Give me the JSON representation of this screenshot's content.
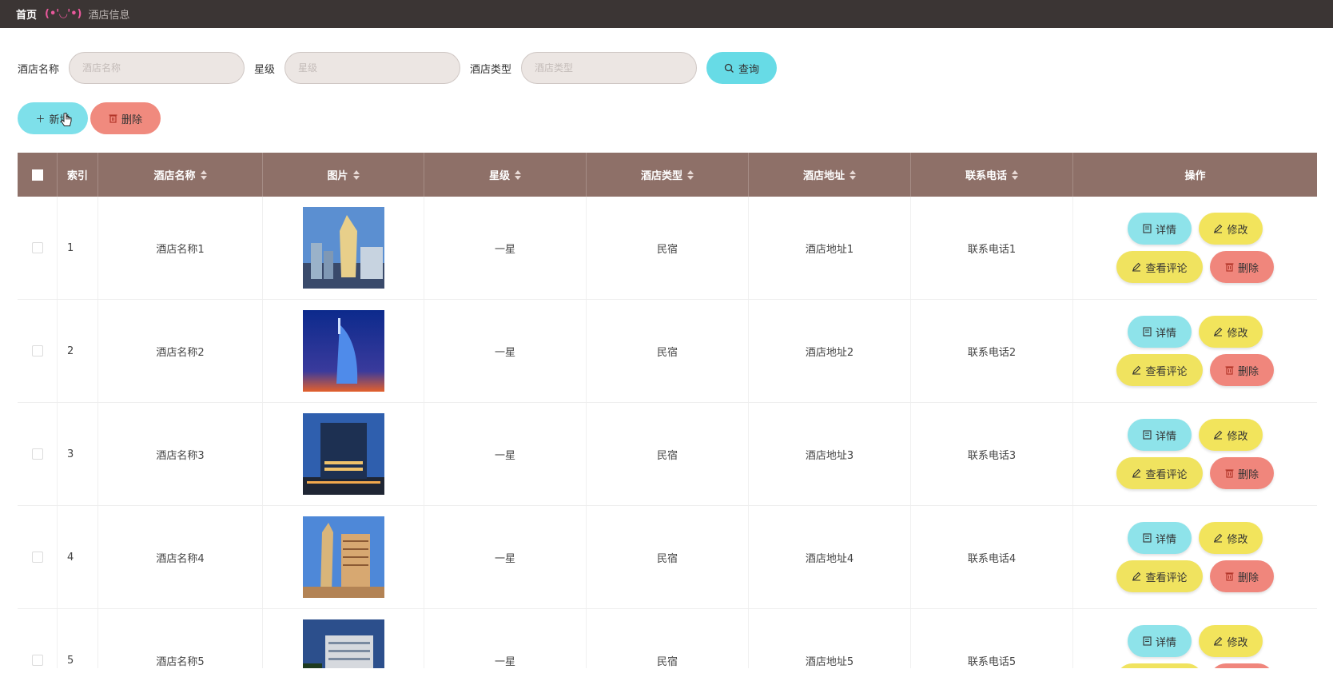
{
  "breadcrumb": {
    "home": "首页",
    "emoji": "(•'◡'•)",
    "current": "酒店信息"
  },
  "search": {
    "fields": [
      {
        "label": "酒店名称",
        "placeholder": "酒店名称"
      },
      {
        "label": "星级",
        "placeholder": "星级"
      },
      {
        "label": "酒店类型",
        "placeholder": "酒店类型"
      }
    ],
    "query_label": "查询"
  },
  "actions": {
    "add_label": "新增",
    "delete_label": "删除"
  },
  "table": {
    "headers": [
      "索引",
      "酒店名称",
      "图片",
      "星级",
      "酒店类型",
      "酒店地址",
      "联系电话",
      "操作"
    ],
    "op_labels": {
      "detail": "详情",
      "edit": "修改",
      "review": "查看评论",
      "delete": "删除"
    },
    "rows": [
      {
        "index": "1",
        "name": "酒店名称1",
        "star": "一星",
        "type": "民宿",
        "address": "酒店地址1",
        "phone": "联系电话1"
      },
      {
        "index": "2",
        "name": "酒店名称2",
        "star": "一星",
        "type": "民宿",
        "address": "酒店地址2",
        "phone": "联系电话2"
      },
      {
        "index": "3",
        "name": "酒店名称3",
        "star": "一星",
        "type": "民宿",
        "address": "酒店地址3",
        "phone": "联系电话3"
      },
      {
        "index": "4",
        "name": "酒店名称4",
        "star": "一星",
        "type": "民宿",
        "address": "酒店地址4",
        "phone": "联系电话4"
      },
      {
        "index": "5",
        "name": "酒店名称5",
        "star": "一星",
        "type": "民宿",
        "address": "酒店地址5",
        "phone": "联系电话5"
      }
    ]
  },
  "colors": {
    "topbar": "#3b3534",
    "header": "#8e7068",
    "cyan": "#67dbe6",
    "yellow": "#f2e45c",
    "red": "#f0867c"
  }
}
